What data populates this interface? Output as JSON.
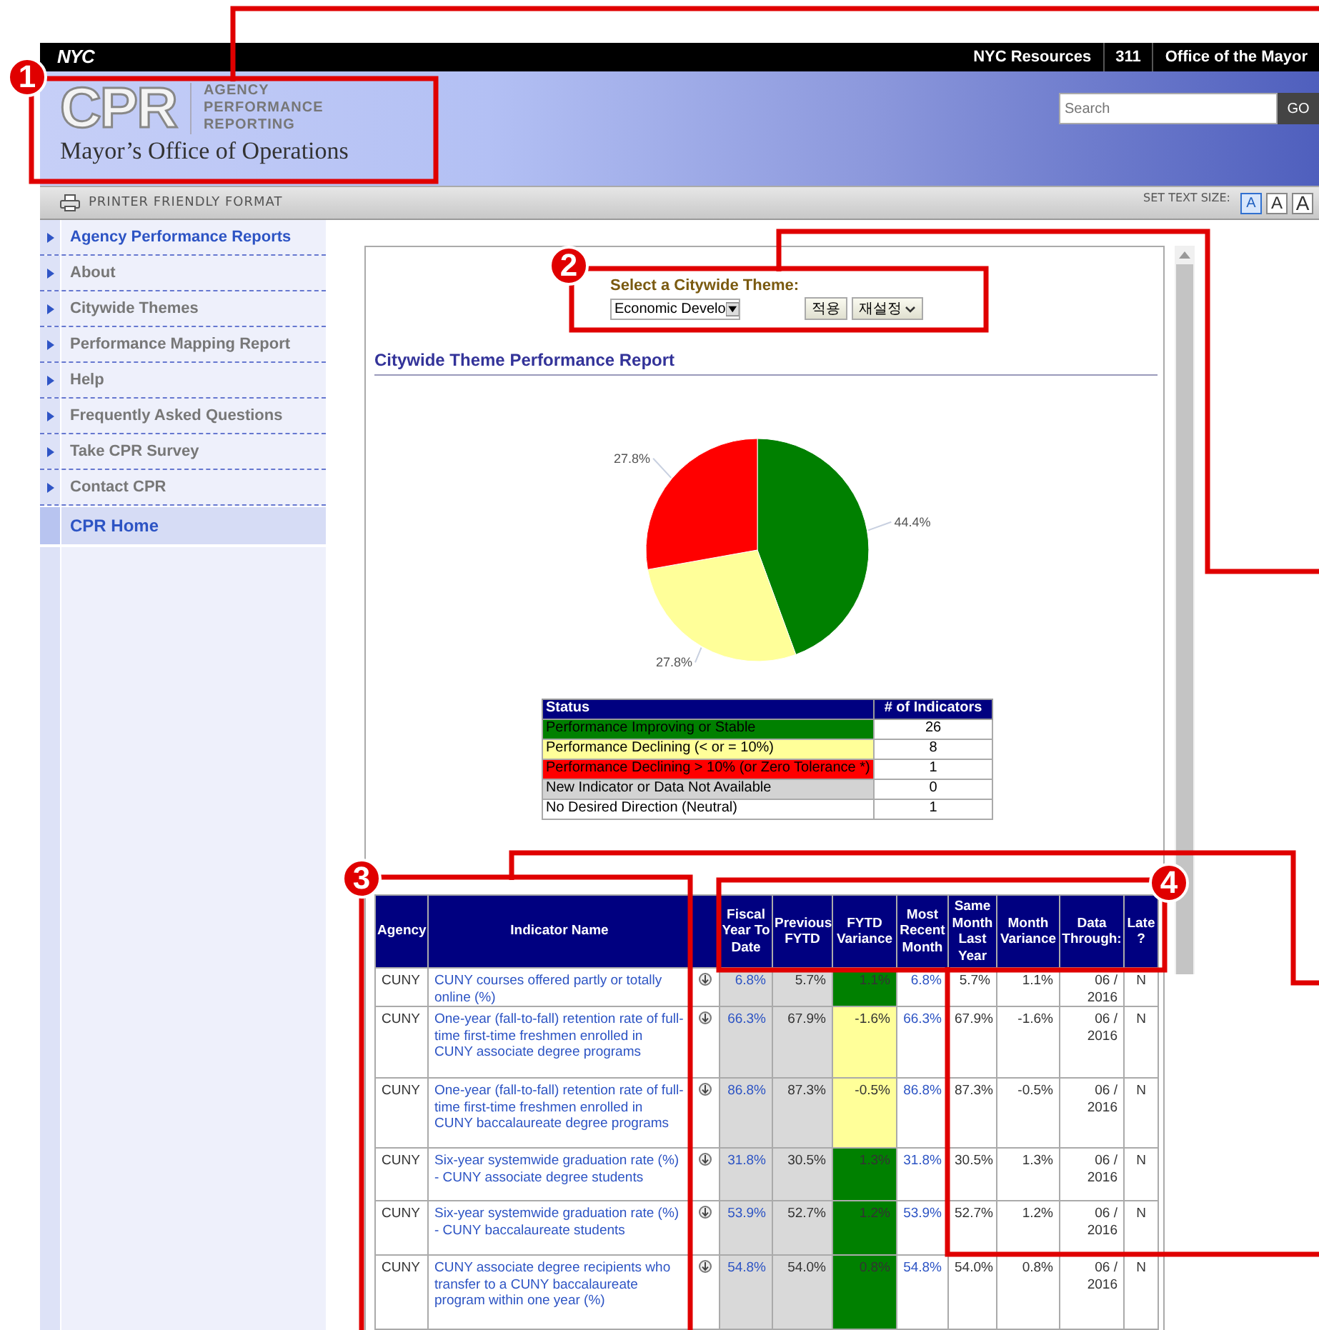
{
  "top_bar": {
    "logo": "NYC",
    "links": [
      "NYC Resources",
      "311",
      "Office of the Mayor"
    ]
  },
  "header": {
    "logo": "CPR",
    "logo_caption": [
      "AGENCY",
      "PERFORMANCE",
      "REPORTING"
    ],
    "subtitle": "Mayor’s Office of Operations",
    "search": {
      "placeholder": "Search"
    },
    "search_button": "GO"
  },
  "toolbar": {
    "print_link": "PRINTER FRIENDLY FORMAT",
    "text_size_label": "SET TEXT SIZE:",
    "text_sizes": [
      {
        "label": "A",
        "selected": true
      },
      {
        "label": "A",
        "selected": false
      },
      {
        "label": "A",
        "selected": false
      }
    ]
  },
  "sidebar": {
    "items": [
      {
        "label": "Agency Performance Reports",
        "active": true,
        "selected": false
      },
      {
        "label": "About",
        "active": false,
        "selected": false
      },
      {
        "label": "Citywide Themes",
        "active": false,
        "selected": false
      },
      {
        "label": "Performance Mapping Report",
        "active": false,
        "selected": false
      },
      {
        "label": "Help",
        "active": false,
        "selected": false
      },
      {
        "label": "Frequently Asked Questions",
        "active": false,
        "selected": false
      },
      {
        "label": "Take CPR Survey",
        "active": false,
        "selected": false
      },
      {
        "label": "Contact CPR",
        "active": false,
        "selected": false
      },
      {
        "label": "CPR Home",
        "active": true,
        "selected": true
      }
    ]
  },
  "theme_selector": {
    "label": "Select a Citywide Theme:",
    "value": "Economic Develo",
    "buttons": [
      "적용",
      "재설정"
    ]
  },
  "report_title": "Citywide Theme Performance Report",
  "chart_data": {
    "type": "pie",
    "values": [
      44.4,
      27.8,
      27.8
    ],
    "colors": [
      "#008000",
      "#ffff99",
      "#ff0000"
    ],
    "value_labels": [
      "44.4%",
      "27.8%",
      "27.8%"
    ],
    "data_labels": true
  },
  "status_table": {
    "columns": [
      "Status",
      "# of Indicators"
    ],
    "rows": [
      {
        "status": "Performance Improving or Stable",
        "count": "26",
        "color": "#008000"
      },
      {
        "status": "Performance Declining (< or = 10%)",
        "count": "8",
        "color": "#ffff99"
      },
      {
        "status": "Performance Declining > 10% (or Zero Tolerance *)",
        "count": "1",
        "color": "#ff0000"
      },
      {
        "status": "New Indicator or Data Not Available",
        "count": "0",
        "color": "#d3d3d3"
      },
      {
        "status": "No Desired Direction (Neutral)",
        "count": "1",
        "color": "#ffffff"
      }
    ]
  },
  "indicator_table": {
    "columns": [
      "Agency",
      "Indicator Name",
      "Fiscal Year To Date",
      "Previous FYTD",
      "FYTD Variance",
      "Most Recent Month",
      "Same Month Last Year",
      "Month Variance",
      "Data Through:",
      "Late ?"
    ],
    "rows": [
      {
        "agency": "CUNY",
        "indicator": "CUNY courses offered partly or totally online (%)",
        "fytd": "6.8%",
        "previous_fytd": "5.7%",
        "fytd_variance": "1.1%",
        "color": "#008000",
        "recent_month": "6.8%",
        "same_month_last_year": "5.7%",
        "month_variance": "1.1%",
        "data_through": "06 / 2016",
        "late": "N"
      },
      {
        "agency": "CUNY",
        "indicator": "One-year (fall-to-fall) retention rate of full-time first-time freshmen enrolled in CUNY associate degree programs",
        "fytd": "66.3%",
        "previous_fytd": "67.9%",
        "fytd_variance": "-1.6%",
        "color": "#ffff99",
        "recent_month": "66.3%",
        "same_month_last_year": "67.9%",
        "month_variance": "-1.6%",
        "data_through": "06 / 2016",
        "late": "N"
      },
      {
        "agency": "CUNY",
        "indicator": "One-year (fall-to-fall) retention rate of full-time first-time freshmen enrolled in CUNY baccalaureate degree programs",
        "fytd": "86.8%",
        "previous_fytd": "87.3%",
        "fytd_variance": "-0.5%",
        "color": "#ffff99",
        "recent_month": "86.8%",
        "same_month_last_year": "87.3%",
        "month_variance": "-0.5%",
        "data_through": "06 / 2016",
        "late": "N"
      },
      {
        "agency": "CUNY",
        "indicator": "Six-year systemwide graduation rate (%) - CUNY associate degree students",
        "fytd": "31.8%",
        "previous_fytd": "30.5%",
        "fytd_variance": "1.3%",
        "color": "#008000",
        "recent_month": "31.8%",
        "same_month_last_year": "30.5%",
        "month_variance": "1.3%",
        "data_through": "06 / 2016",
        "late": "N"
      },
      {
        "agency": "CUNY",
        "indicator": "Six-year systemwide graduation rate (%) - CUNY baccalaureate students",
        "fytd": "53.9%",
        "previous_fytd": "52.7%",
        "fytd_variance": "1.2%",
        "color": "#008000",
        "recent_month": "53.9%",
        "same_month_last_year": "52.7%",
        "month_variance": "1.2%",
        "data_through": "06 / 2016",
        "late": "N"
      },
      {
        "agency": "CUNY",
        "indicator": "CUNY associate degree recipients who transfer to a CUNY baccalaureate program within one year (%)",
        "fytd": "54.8%",
        "previous_fytd": "54.0%",
        "fytd_variance": "0.8%",
        "color": "#008000",
        "recent_month": "54.8%",
        "same_month_last_year": "54.0%",
        "month_variance": "0.8%",
        "data_through": "06 / 2016",
        "late": "N"
      }
    ]
  },
  "annotations": [
    {
      "number": "1"
    },
    {
      "number": "2"
    },
    {
      "number": "3"
    },
    {
      "number": "4"
    }
  ]
}
